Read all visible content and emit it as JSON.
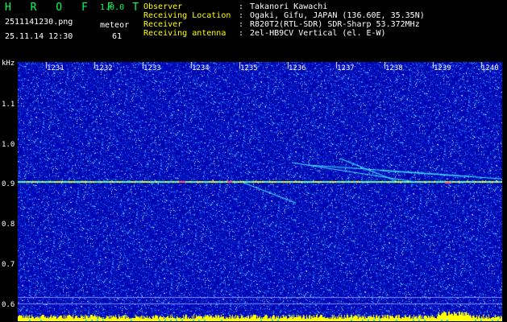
{
  "header": {
    "app_title": "H R O F F T",
    "version": "1.0.0",
    "filename": "2511141230.png",
    "datetime": "25.11.14 12:30",
    "meteor_label": "meteor",
    "meteor_count": "61"
  },
  "info": [
    {
      "key": "Observer",
      "sep": ":",
      "value": "Takanori Kawachi"
    },
    {
      "key": "Receiving Location",
      "sep": ":",
      "value": "Ogaki, Gifu, JAPAN (136.60E, 35.35N)"
    },
    {
      "key": "Receiver",
      "sep": ":",
      "value": "R820T2(RTL-SDR) SDR-Sharp 53.372MHz"
    },
    {
      "key": "Receiving antenna",
      "sep": ":",
      "value": "2el-HB9CV Vertical (el. E-W)"
    }
  ],
  "axis": {
    "unit": "kHz",
    "y_labels": [
      "1.1",
      "1.0",
      "0.9",
      "0.8",
      "0.7",
      "0.6"
    ],
    "minute_labels": [
      "1231",
      "1232",
      "1233",
      "1234",
      "1235",
      "1236",
      "1237",
      "1238",
      "1239",
      "1240"
    ]
  },
  "colors": {
    "background": "#000000",
    "spectrogram_base": "#0000aa",
    "title": "#00ff66",
    "info_key": "#ffff00",
    "carrier": "#ffff00"
  }
}
